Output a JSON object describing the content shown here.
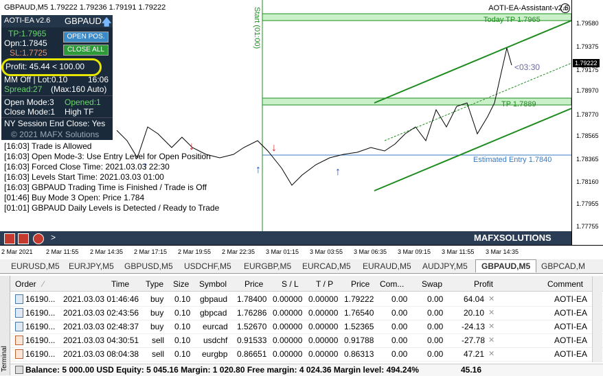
{
  "chart": {
    "title": "GBPAUD,M5  1.79222 1.79236 1.79191 1.79222",
    "ea_title": "AOTI-EA-Assistant-v2.6",
    "start_label": "Start (01:00)",
    "today_tp_label": "Today TP 1.7965",
    "tp_label": "TP 1.7889",
    "estimated_entry_label": "Estimated Entry 1.7840",
    "countdown": "<03:30",
    "price_axis": [
      "1.79580",
      "1.79375",
      "1.79175",
      "1.78970",
      "1.78770",
      "1.78565",
      "1.78365",
      "1.78160",
      "1.77955",
      "1.77755"
    ],
    "current_price": "1.79222",
    "time_axis": [
      "2 Mar 2021",
      "2 Mar 11:55",
      "2 Mar 14:35",
      "2 Mar 17:15",
      "2 Mar 19:55",
      "2 Mar 22:35",
      "3 Mar 01:15",
      "3 Mar 03:55",
      "3 Mar 06:35",
      "3 Mar 09:15",
      "3 Mar 11:55",
      "3 Mar 14:35"
    ],
    "colors": {
      "channel": "#1f8c1f",
      "entry_line": "#3a7ac0",
      "panel_bg": "#1a2a3a",
      "highlight": "#e6e600"
    }
  },
  "panel": {
    "name": "AOTI-EA v2.6",
    "symbol": "GBPAUD",
    "tp": "TP:1.7965",
    "open": "Opn:1.7845",
    "sl": "SL:1.7725",
    "open_pos_button": "OPEN POS.",
    "close_all_button": "CLOSE ALL",
    "profit": "Profit:  45.44 < 100.00",
    "mm_line": "MM Off | Lot:0.10",
    "time": "16:06",
    "spread": "Spread:27",
    "max_spread": "(Max:160 Auto)",
    "open_mode": "Open Mode:3",
    "opened": "Opened:1",
    "close_mode": "Close Mode:1",
    "high_tf": "High TF",
    "ny_close": "NY Session End Close: Yes",
    "copyright": "© 2021 MAFX Solutions"
  },
  "log": [
    "[16:03]  Trade is Allowed",
    "[16:03]  Open Mode-3: Use Entry Level for Open Position",
    "[16:03]  Forced Close Time: 2021.03.03 22:30",
    "[16:03]  Levels Start Time: 2021.03.03 01:00",
    "[16:03]  GBPAUD Trading Time is Finished / Trade is Off",
    "[01:46]  Buy Mode 3 Open: Price 1.784",
    "[01:01]  GBPAUD Daily Levels is Detected / Ready to Trade"
  ],
  "toolbar": {
    "arrow": ">",
    "brand": "MAFXSOLUTIONS"
  },
  "tabs": [
    "EURUSD,M5",
    "EURJPY,M5",
    "GBPUSD,M5",
    "USDCHF,M5",
    "EURGBP,M5",
    "EURCAD,M5",
    "EURAUD,M5",
    "AUDJPY,M5",
    "GBPAUD,M5",
    "GBPCAD,M"
  ],
  "active_tab": "GBPAUD,M5",
  "table": {
    "headers": [
      "Order",
      "Time",
      "Type",
      "Size",
      "Symbol",
      "Price",
      "S / L",
      "T / P",
      "Price",
      "Com...",
      "Swap",
      "Profit",
      "Comment"
    ],
    "rows": [
      {
        "order": "16190...",
        "time": "2021.03.03 01:46:46",
        "type": "buy",
        "size": "0.10",
        "symbol": "gbpaud",
        "price": "1.78400",
        "sl": "0.00000",
        "tp": "0.00000",
        "cur": "1.79222",
        "com": "0.00",
        "swap": "0.00",
        "profit": "64.04",
        "comment": "AOTI-EA"
      },
      {
        "order": "16190...",
        "time": "2021.03.03 02:43:56",
        "type": "buy",
        "size": "0.10",
        "symbol": "gbpcad",
        "price": "1.76286",
        "sl": "0.00000",
        "tp": "0.00000",
        "cur": "1.76540",
        "com": "0.00",
        "swap": "0.00",
        "profit": "20.10",
        "comment": "AOTI-EA"
      },
      {
        "order": "16190...",
        "time": "2021.03.03 02:48:37",
        "type": "buy",
        "size": "0.10",
        "symbol": "eurcad",
        "price": "1.52670",
        "sl": "0.00000",
        "tp": "0.00000",
        "cur": "1.52365",
        "com": "0.00",
        "swap": "0.00",
        "profit": "-24.13",
        "comment": "AOTI-EA"
      },
      {
        "order": "16190...",
        "time": "2021.03.03 04:30:51",
        "type": "sell",
        "size": "0.10",
        "symbol": "usdchf",
        "price": "0.91533",
        "sl": "0.00000",
        "tp": "0.00000",
        "cur": "0.91788",
        "com": "0.00",
        "swap": "0.00",
        "profit": "-27.78",
        "comment": "AOTI-EA"
      },
      {
        "order": "16190...",
        "time": "2021.03.03 08:04:38",
        "type": "sell",
        "size": "0.10",
        "symbol": "eurgbp",
        "price": "0.86651",
        "sl": "0.00000",
        "tp": "0.00000",
        "cur": "0.86313",
        "com": "0.00",
        "swap": "0.00",
        "profit": "47.21",
        "comment": "AOTI-EA"
      }
    ],
    "balance_line": "Balance: 5 000.00 USD  Equity: 5 045.16  Margin: 1 020.80  Free margin: 4 024.36  Margin level: 494.24%",
    "total": "45.16",
    "terminal_label": "Terminal"
  }
}
